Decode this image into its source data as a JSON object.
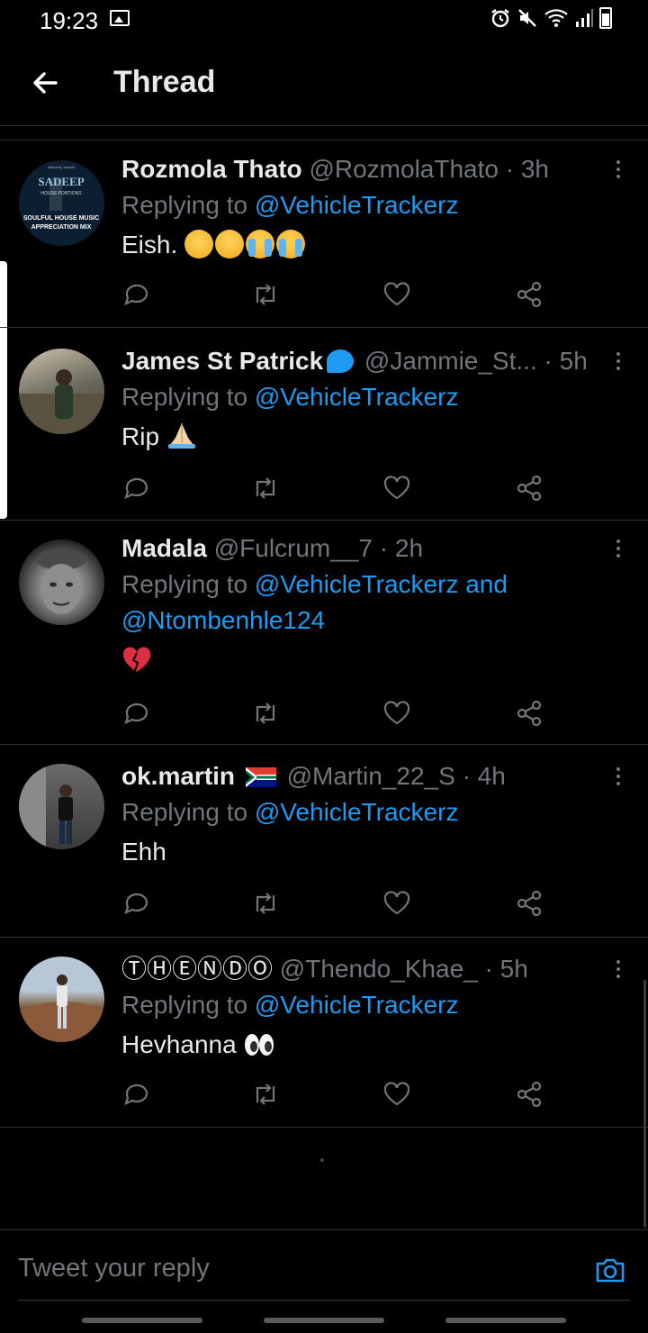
{
  "status_bar": {
    "time": "19:23"
  },
  "header": {
    "title": "Thread"
  },
  "tweets": [
    {
      "name": "Rozmola Thato",
      "handle": "@RozmolaThato",
      "separator": "·",
      "time": "3h",
      "replying_prefix": "Replying to",
      "mentions": "@VehicleTrackerz",
      "text": "Eish.",
      "avatar_text": {
        "brand": "SADEEP",
        "sub1": "HOUSE PORTIONS",
        "sub2": "SOULFUL HOUSE MUSIC",
        "sub3": "APPRECIATION MIX",
        "top": "Mixed by vewahi"
      }
    },
    {
      "name": "James St Patrick",
      "handle": "@Jammie_St...",
      "separator": "·",
      "time": "5h",
      "replying_prefix": "Replying to",
      "mentions": "@VehicleTrackerz",
      "text": "Rip"
    },
    {
      "name": "Madala",
      "handle": "@Fulcrum__7",
      "separator": "·",
      "time": "2h",
      "replying_prefix": "Replying to",
      "mentions": "@VehicleTrackerz and @Ntombenhle124",
      "text": ""
    },
    {
      "name": "ok.martin",
      "handle": "@Martin_22_S",
      "separator": "·",
      "time": "4h",
      "replying_prefix": "Replying to",
      "mentions": "@VehicleTrackerz",
      "text": "Ehh"
    },
    {
      "name": "ⓉⒽⒺⓃⒹⓄ",
      "handle": "@Thendo_Khae_",
      "separator": "·",
      "time": "5h",
      "replying_prefix": "Replying to",
      "mentions": "@VehicleTrackerz",
      "text": "Hevhanna"
    }
  ],
  "reply": {
    "placeholder": "Tweet your reply"
  },
  "colors": {
    "background": "#000000",
    "accent": "#1d9bf0",
    "muted": "#71767b",
    "text": "#e7e9ea",
    "divider": "#2f3336"
  },
  "icons": [
    "back-arrow-icon",
    "more-icon",
    "reply-icon",
    "retweet-icon",
    "like-icon",
    "share-icon",
    "camera-icon"
  ]
}
